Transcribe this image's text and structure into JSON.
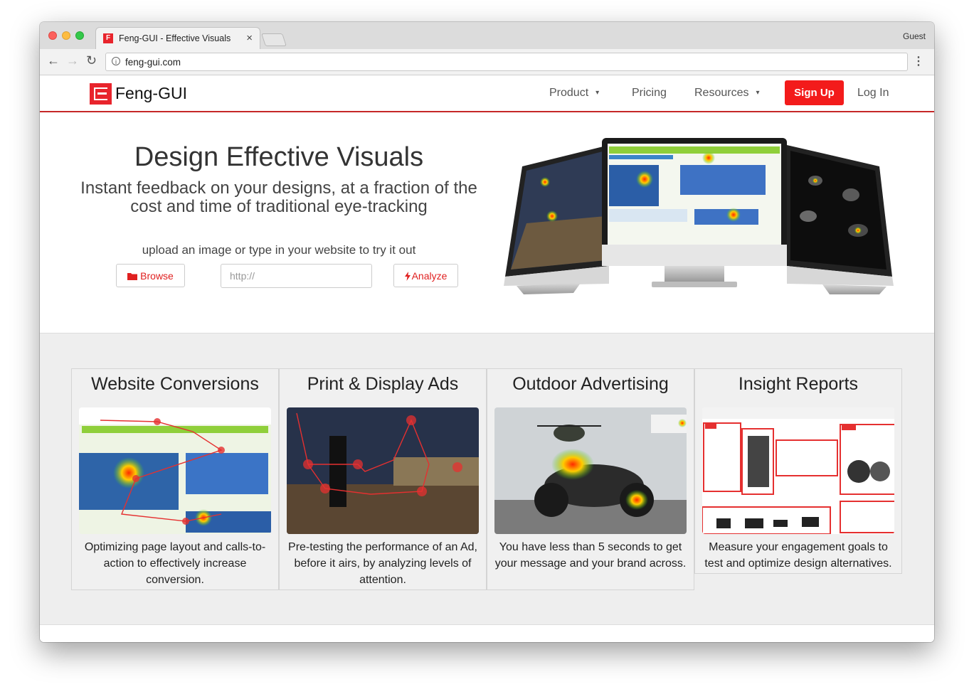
{
  "browser": {
    "tab_title": "Feng-GUI - Effective Visuals",
    "tab_close": "×",
    "profile": "Guest",
    "url": "feng-gui.com",
    "back": "←",
    "forward": "→",
    "reload": "↻",
    "menu": "⋮",
    "favicon_letter": "F",
    "info": "i"
  },
  "nav": {
    "logo_text": "Feng-GUI",
    "product": "Product",
    "pricing": "Pricing",
    "resources": "Resources",
    "caret": "▾",
    "signup": "Sign Up",
    "login": "Log In"
  },
  "hero": {
    "title": "Design Effective Visuals",
    "subtitle": "Instant feedback on your designs, at a fraction of the cost and time of traditional eye-tracking",
    "cta_text": "upload an image or type in your website to try it out",
    "browse_label": "Browse",
    "url_placeholder": "http://",
    "analyze_label": "Analyze"
  },
  "features": [
    {
      "title": "Website Conversions",
      "desc": "Optimizing page layout and calls-to-action to effectively increase conversion."
    },
    {
      "title": "Print & Display Ads",
      "desc": "Pre-testing the performance of an Ad, before it airs, by analyzing levels of attention."
    },
    {
      "title": "Outdoor Advertising",
      "desc": "You have less than 5 seconds to get your message and your brand across."
    },
    {
      "title": "Insight Reports",
      "desc": "Measure your engagement goals to test and optimize design alternatives."
    }
  ],
  "colors": {
    "brand_red": "#e8242c",
    "signup_bg": "#f31b1b",
    "features_bg": "#eeeeee"
  },
  "icons": {
    "browse": "folder-icon",
    "analyze": "bolt-icon"
  }
}
